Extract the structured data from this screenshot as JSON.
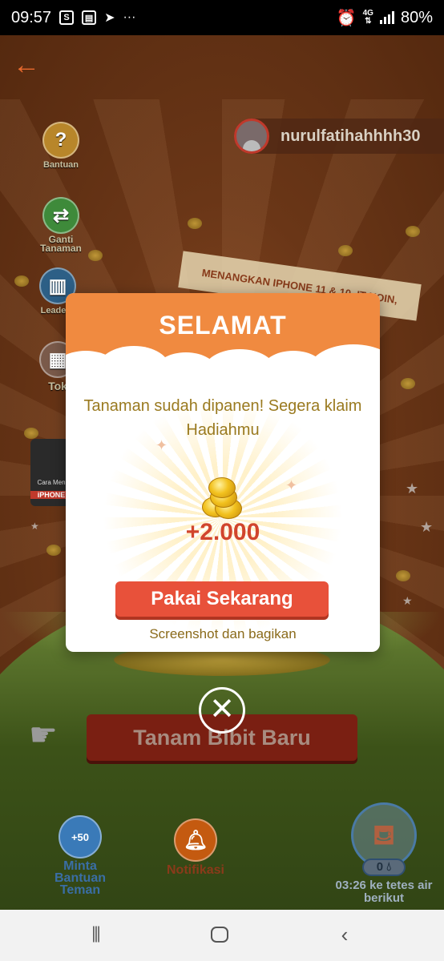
{
  "status_bar": {
    "time": "09:57",
    "network": "4G",
    "battery": "80%",
    "more": "···"
  },
  "game": {
    "user_name": "nurulfatihahhhh30",
    "promo_banner": "MENANGKAN IPHONE 11 & 10. IT KOIN,",
    "menu": {
      "help": "Bantuan",
      "change_plant": "Ganti Tanaman",
      "leaderboard": "Leaderb",
      "shop": "Tok",
      "iphone_promo_small": "Cara Men",
      "iphone_label": "iPHONE"
    },
    "plant_button": "Tanam Bibit Baru",
    "bottom": {
      "help_friend_badge": "+50",
      "help_friend": "Minta Bantuan Teman",
      "notifications": "Notifikasi",
      "water_count": "0",
      "water_timer": "03:26 ke tetes air berikut"
    }
  },
  "modal": {
    "title": "SELAMAT",
    "message": "Tanaman sudah dipanen! Segera klaim Hadiahmu",
    "reward": "+2.000",
    "use_button": "Pakai Sekarang",
    "share_link": "Screenshot dan bagikan"
  },
  "icons": {
    "back": "back-arrow-icon",
    "close": "close-icon",
    "coins": "coin-stack-icon",
    "bell": "bell-icon",
    "watering_can": "watering-can-icon"
  },
  "colors": {
    "header_orange": "#f08a40",
    "button_red": "#e8513a",
    "reward_red": "#d1452d",
    "message_gold": "#9a7a20"
  }
}
